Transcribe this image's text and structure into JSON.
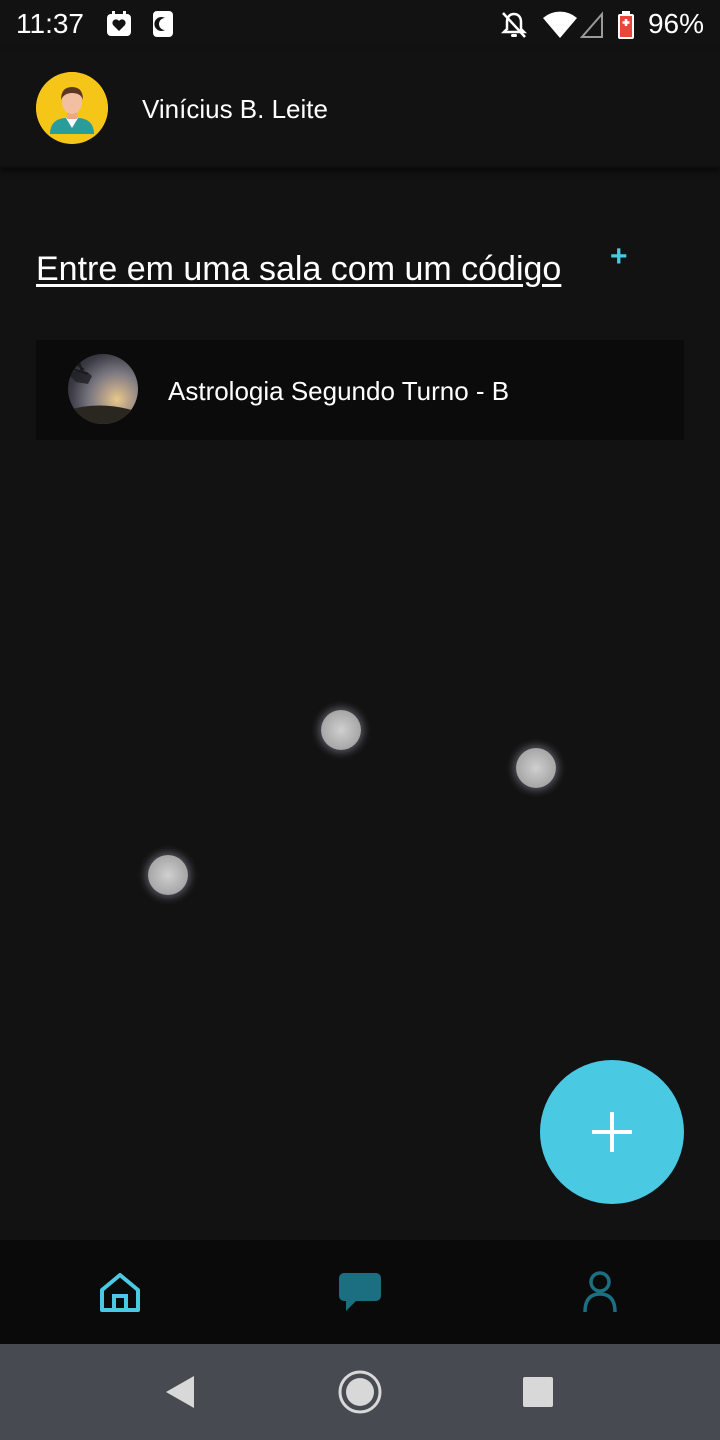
{
  "status_bar": {
    "time": "11:37",
    "battery_percent": "96%",
    "left_icons": [
      "heart-calendar-icon",
      "moon-icon"
    ],
    "right_icons": [
      "notifications-off-icon",
      "wifi-icon",
      "signal-icon",
      "battery-charging-icon"
    ]
  },
  "header": {
    "user_name": "Vinícius B. Leite",
    "avatar_color": "#f5c518"
  },
  "main": {
    "join_link": "Entre em uma sala com um código",
    "join_plus": "+",
    "rooms": [
      {
        "name": "Astrologia Segundo Turno - B"
      }
    ]
  },
  "fab": {
    "icon": "plus-icon"
  },
  "bottom_nav": {
    "items": [
      {
        "id": "home",
        "icon": "home-icon",
        "active": true
      },
      {
        "id": "chat",
        "icon": "chat-icon",
        "active": false
      },
      {
        "id": "profile",
        "icon": "person-icon",
        "active": false
      }
    ]
  },
  "colors": {
    "accent": "#4ac9e3",
    "background": "#121212",
    "nav_inactive": "#1b6f80"
  }
}
